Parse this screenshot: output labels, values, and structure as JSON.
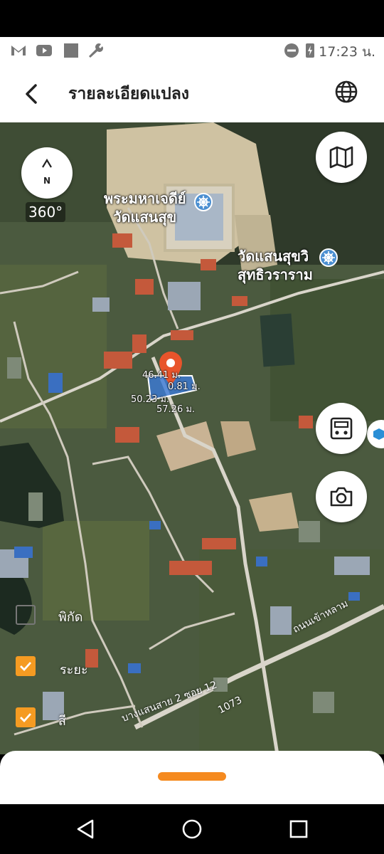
{
  "status": {
    "time": "17:23 น.",
    "icons": [
      "gmail-icon",
      "youtube-icon",
      "square-icon",
      "wrench-icon",
      "dnd-icon",
      "battery-icon"
    ]
  },
  "appbar": {
    "title": "รายละเอียดแปลง",
    "back_icon": "back-arrow-icon",
    "globe_icon": "globe-icon"
  },
  "map": {
    "compass_label": "N",
    "rotation_label": "360°",
    "places": {
      "temple_pagoda": "พระมหาเจดีย์\nวัดแสนสุข",
      "temple_line1": "วัดแสนสุขวิ",
      "temple_line2": "สุทธิวราราม"
    },
    "plot_dimensions": {
      "top": "46.41 ม.",
      "right": "0.81 ม.",
      "left": "50.23 ม.",
      "bottom": "57.26 ม."
    },
    "roads": {
      "road_main": "ถนนเข้าหลาม",
      "road_route": "1073",
      "road_soi": "บางแสนสาย 2 ซอย 12"
    },
    "layers": [
      {
        "label": "พิกัด",
        "checked": false
      },
      {
        "label": "ระยะ",
        "checked": true
      },
      {
        "label": "สี",
        "checked": true
      }
    ]
  },
  "colors": {
    "accent": "#f58a1f",
    "plot_fill": "#3b7bd9",
    "pin": "#e8542b"
  }
}
